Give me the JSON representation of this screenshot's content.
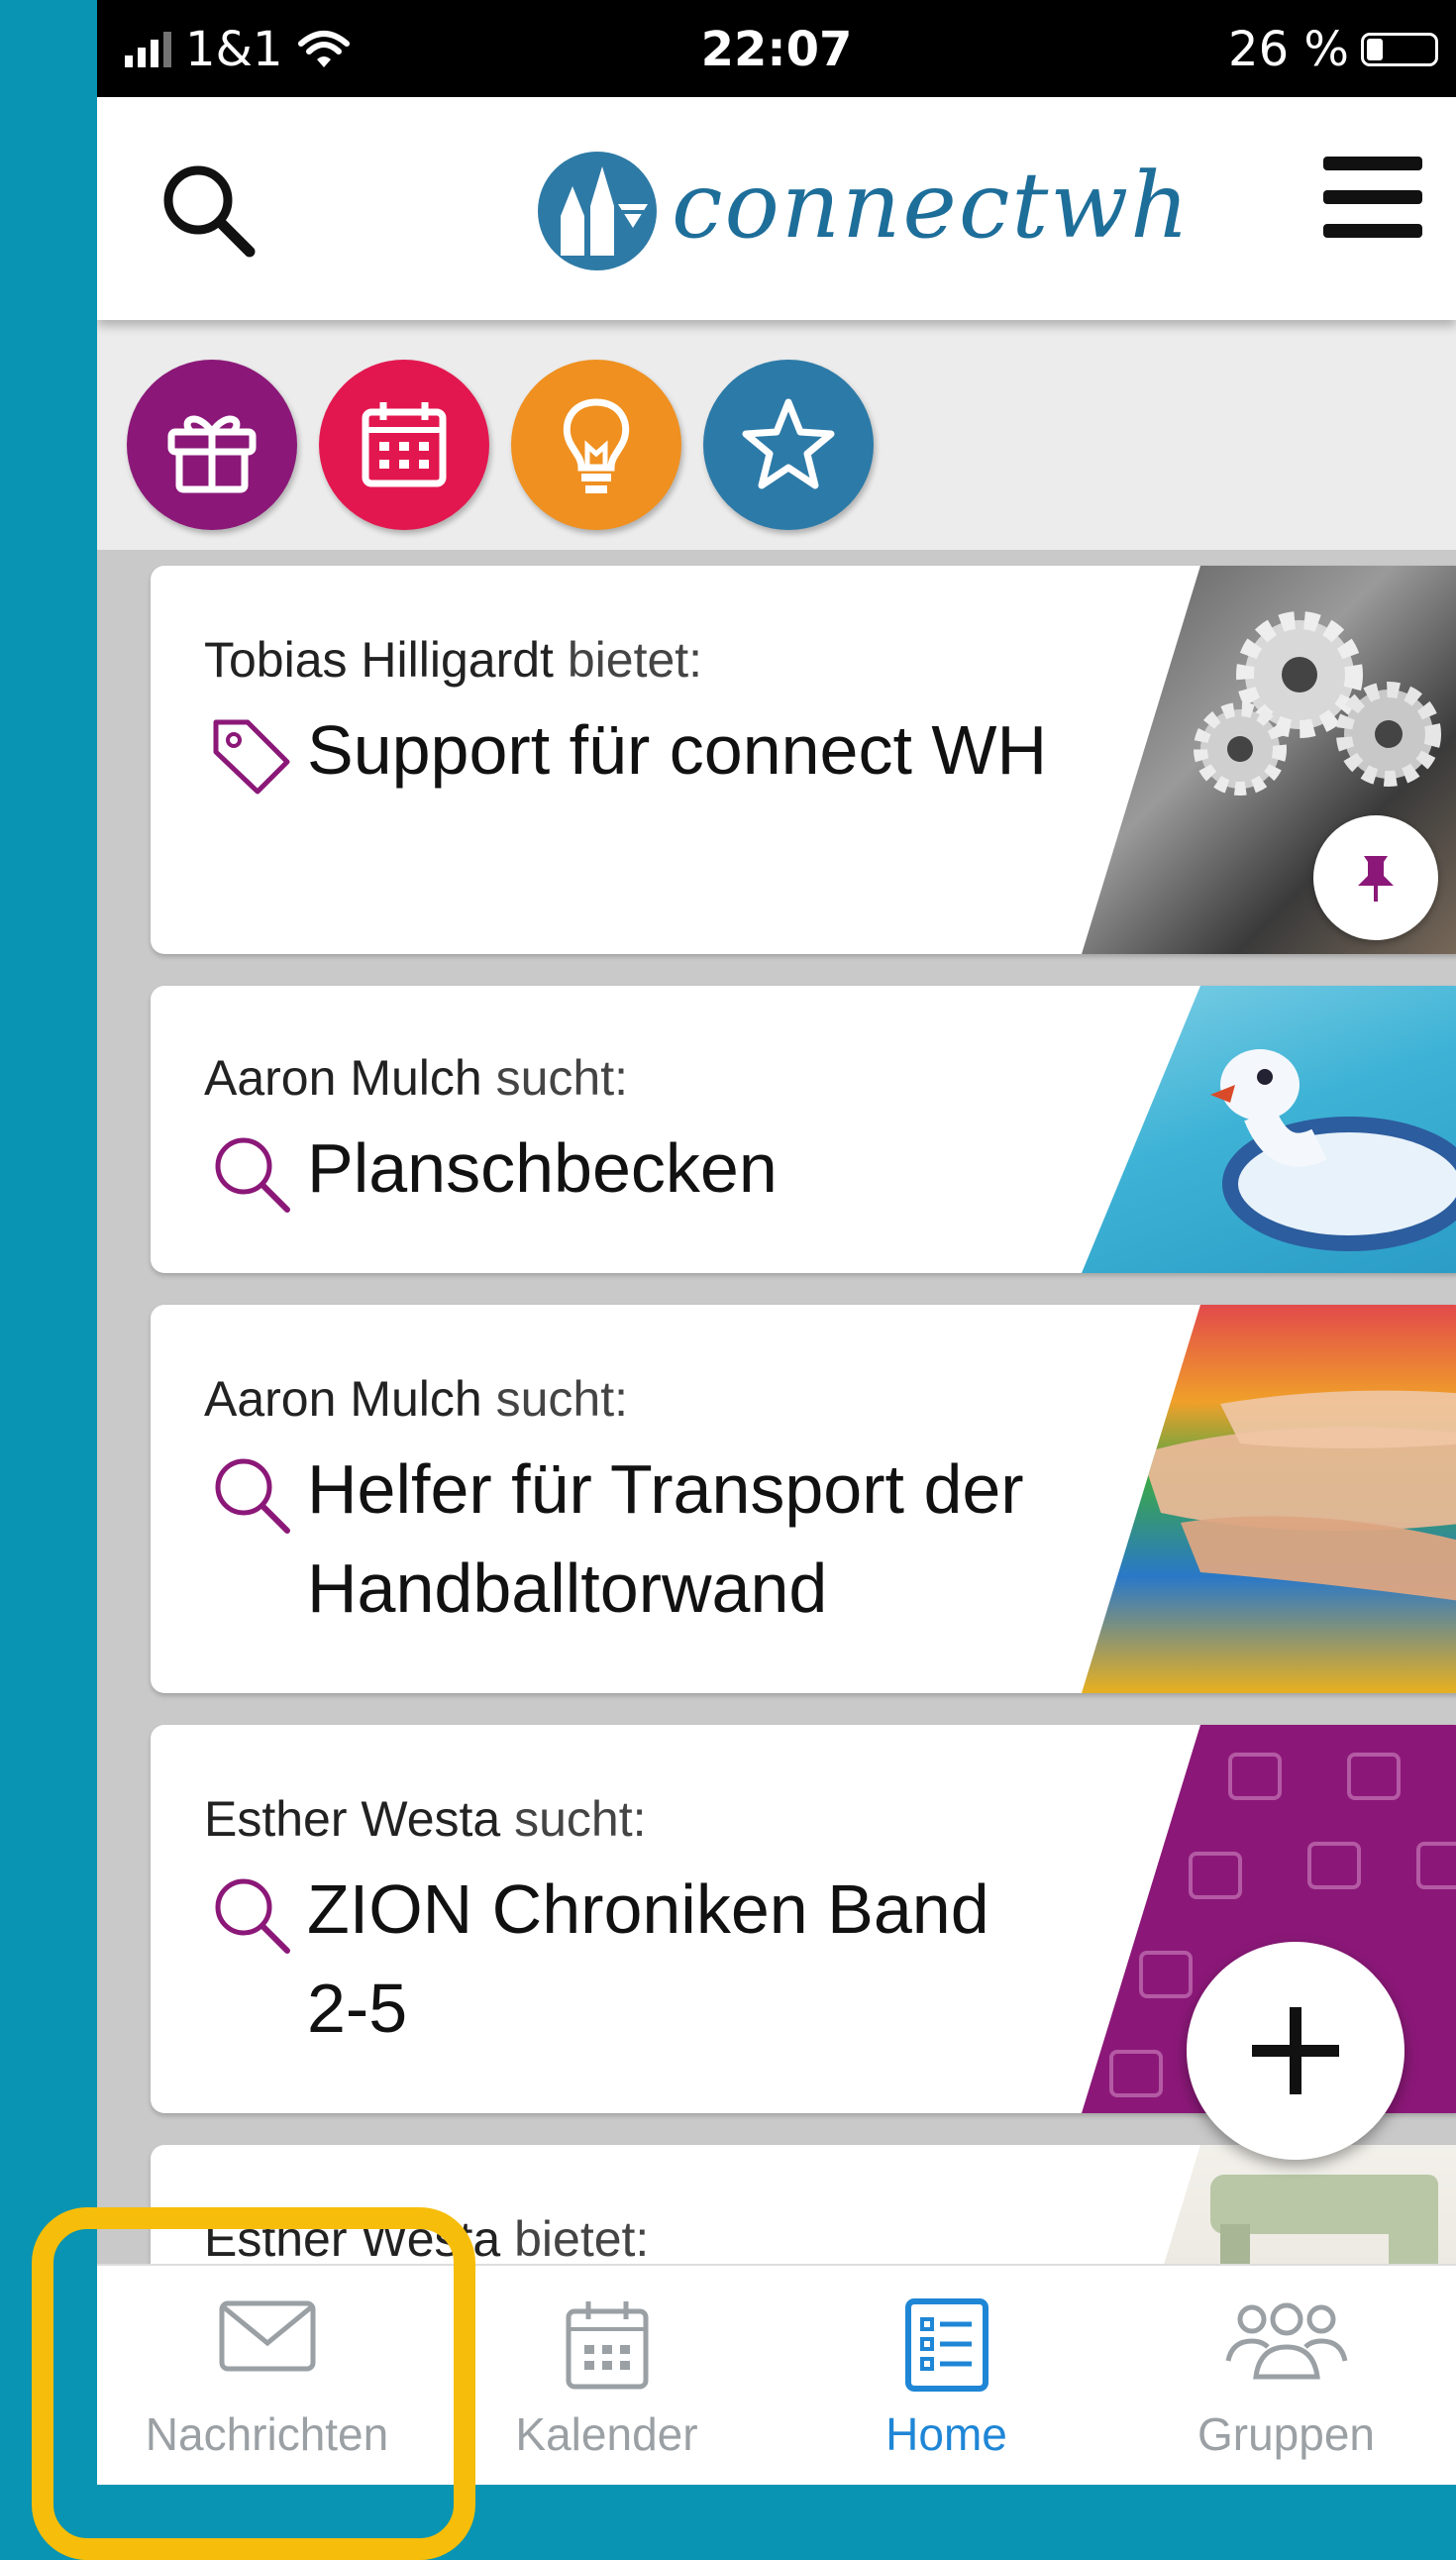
{
  "status_bar": {
    "carrier": "1&1",
    "time": "22:07",
    "battery": "26 %"
  },
  "header": {
    "logo_text": "connectwh",
    "logo_icon": "church-icon"
  },
  "categories": [
    {
      "name": "gift-icon",
      "color": "#8b1878"
    },
    {
      "name": "calendar-icon",
      "color": "#e3174f"
    },
    {
      "name": "lightbulb-icon",
      "color": "#ef9020"
    },
    {
      "name": "star-icon",
      "color": "#2c7aa8"
    }
  ],
  "cards": [
    {
      "name": "Tobias Hilligardt",
      "role": "bietet:",
      "title": "Support für connect WH",
      "icon": "tag-icon",
      "image": "gears-photo",
      "pinned": true
    },
    {
      "name": "Aaron Mulch",
      "role": "sucht:",
      "title": "Planschbecken",
      "icon": "search-icon",
      "image": "pool-float-photo"
    },
    {
      "name": "Aaron Mulch",
      "role": "sucht:",
      "title": "Helfer für Transport der Handballtorwand",
      "icon": "search-icon",
      "image": "hands-photo"
    },
    {
      "name": "Esther Westa",
      "role": "sucht:",
      "title": "ZION Chroniken Band 2-5",
      "icon": "search-icon",
      "image": "gift-pattern"
    },
    {
      "name": "Esther Westa",
      "role": "bietet:",
      "title": "",
      "icon": "tag-icon",
      "image": "sewing-machine-photo"
    }
  ],
  "nav": [
    {
      "label": "Nachrichten",
      "icon": "envelope-icon"
    },
    {
      "label": "Kalender",
      "icon": "calendar-icon"
    },
    {
      "label": "Home",
      "icon": "list-icon",
      "active": true
    },
    {
      "label": "Gruppen",
      "icon": "group-icon"
    }
  ],
  "colors": {
    "accent": "#1f86d6",
    "highlight": "#f6bd0a",
    "frame": "#0894b2",
    "purple": "#8b1878"
  }
}
